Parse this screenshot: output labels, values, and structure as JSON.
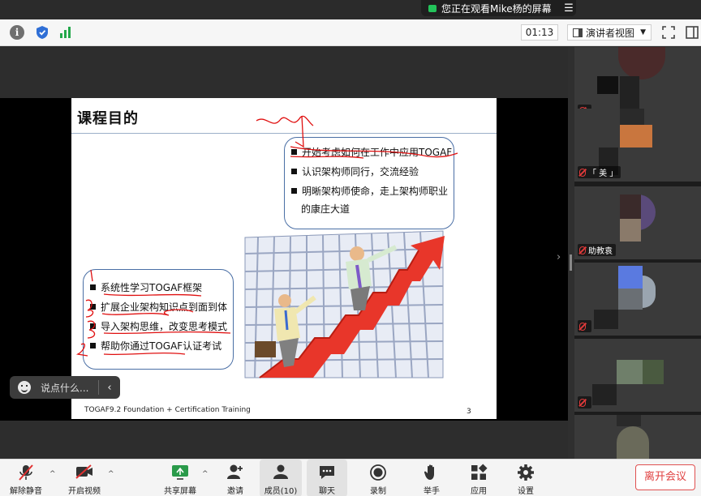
{
  "share_banner": {
    "text": "您正在观看Mike杨的屏幕"
  },
  "toolbar": {
    "timer": "01:13",
    "view_label": "演讲者视图"
  },
  "slide": {
    "title": "课程目的",
    "right_bubble": [
      "开始考虑如何在工作中应用TOGAF",
      "认识架构师同行，交流经验",
      "明晰架构师使命，走上架构师职业",
      "的康庄大道"
    ],
    "left_bubble": [
      "系统性学习TOGAF框架",
      "扩展企业架构知识点到面到体",
      "导入架构思维，改变思考模式",
      "帮助你通过TOGAF认证考试"
    ],
    "footer": "TOGAF9.2 Foundation + Certification Training",
    "page": "3"
  },
  "chat": {
    "placeholder": "说点什么..."
  },
  "participants": [
    {
      "name": ""
    },
    {
      "name": "「 美 」"
    },
    {
      "name": "助教袁"
    },
    {
      "name": ""
    },
    {
      "name": ""
    },
    {
      "name": ""
    }
  ],
  "bottom": {
    "unmute": "解除静音",
    "video": "开启视频",
    "share": "共享屏幕",
    "invite": "邀请",
    "members": "成员(10)",
    "chat": "聊天",
    "record": "录制",
    "raise_hand": "举手",
    "apps": "应用",
    "settings": "设置",
    "leave": "离开会议"
  },
  "colors": {
    "accent_green": "#23c35a",
    "leave_red": "#e04040",
    "scribble_red": "#e01010",
    "arrow_red": "#e8362a"
  }
}
